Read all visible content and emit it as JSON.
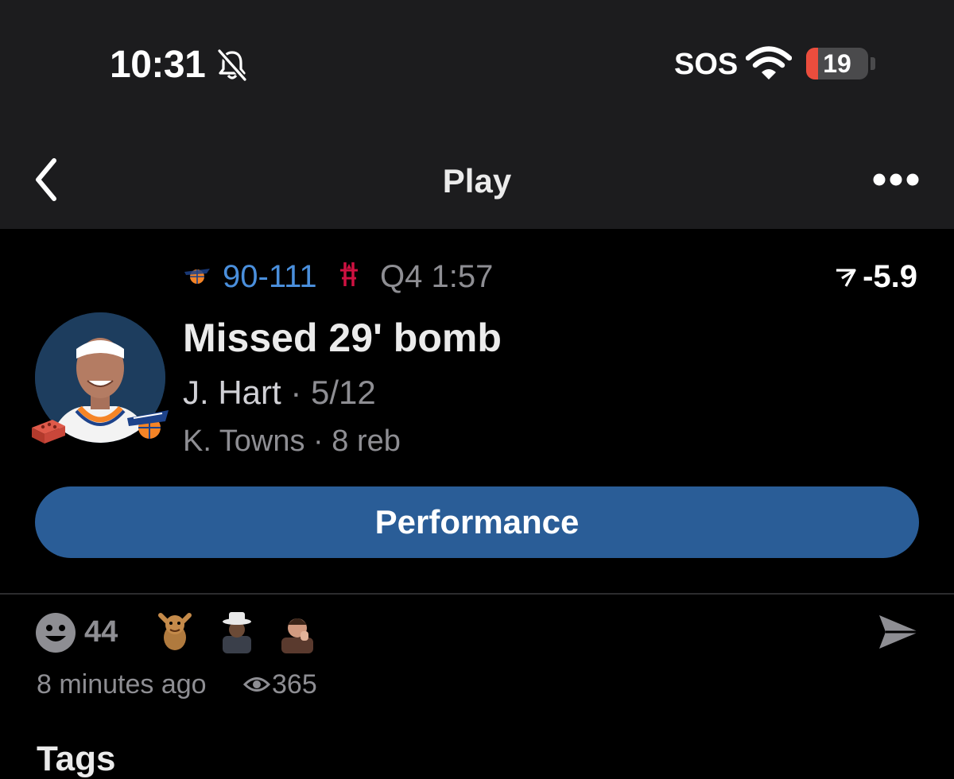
{
  "status_bar": {
    "time": "10:31",
    "carrier_text": "SOS",
    "battery_level": "19",
    "battery_fraction": 0.19,
    "icons": [
      "bell-slash-icon",
      "wifi-icon",
      "battery-icon"
    ]
  },
  "nav": {
    "title": "Play",
    "back_icon": "chevron-left-icon",
    "more_icon": "ellipsis-icon"
  },
  "game": {
    "score": "90-111",
    "clock": "Q4 1:57",
    "win_prob_change": "-5.9",
    "home_logo": "knicks-logo-icon",
    "away_logo": "rockets-logo-icon"
  },
  "play": {
    "title": "Missed 29' bomb",
    "shooter_name": "J. Hart",
    "shooter_separator": "·",
    "shooter_stat": "5/12",
    "rebounder_name": "K. Towns",
    "rebounder_separator": "·",
    "rebounder_stat": "8 reb"
  },
  "actions": {
    "performance_label": "Performance"
  },
  "reactions": {
    "count": "44",
    "icons": [
      "smiley-icon",
      "reaction-cartoon-icon",
      "reaction-hat-icon",
      "reaction-person-icon"
    ]
  },
  "meta": {
    "time_ago": "8 minutes ago",
    "views": "365"
  },
  "sections": {
    "tags_label": "Tags"
  },
  "colors": {
    "accent_blue": "#4a8fdc",
    "button_blue": "#2a5d97",
    "battery_red": "#eb4d3d",
    "rockets_red": "#ce1141"
  }
}
